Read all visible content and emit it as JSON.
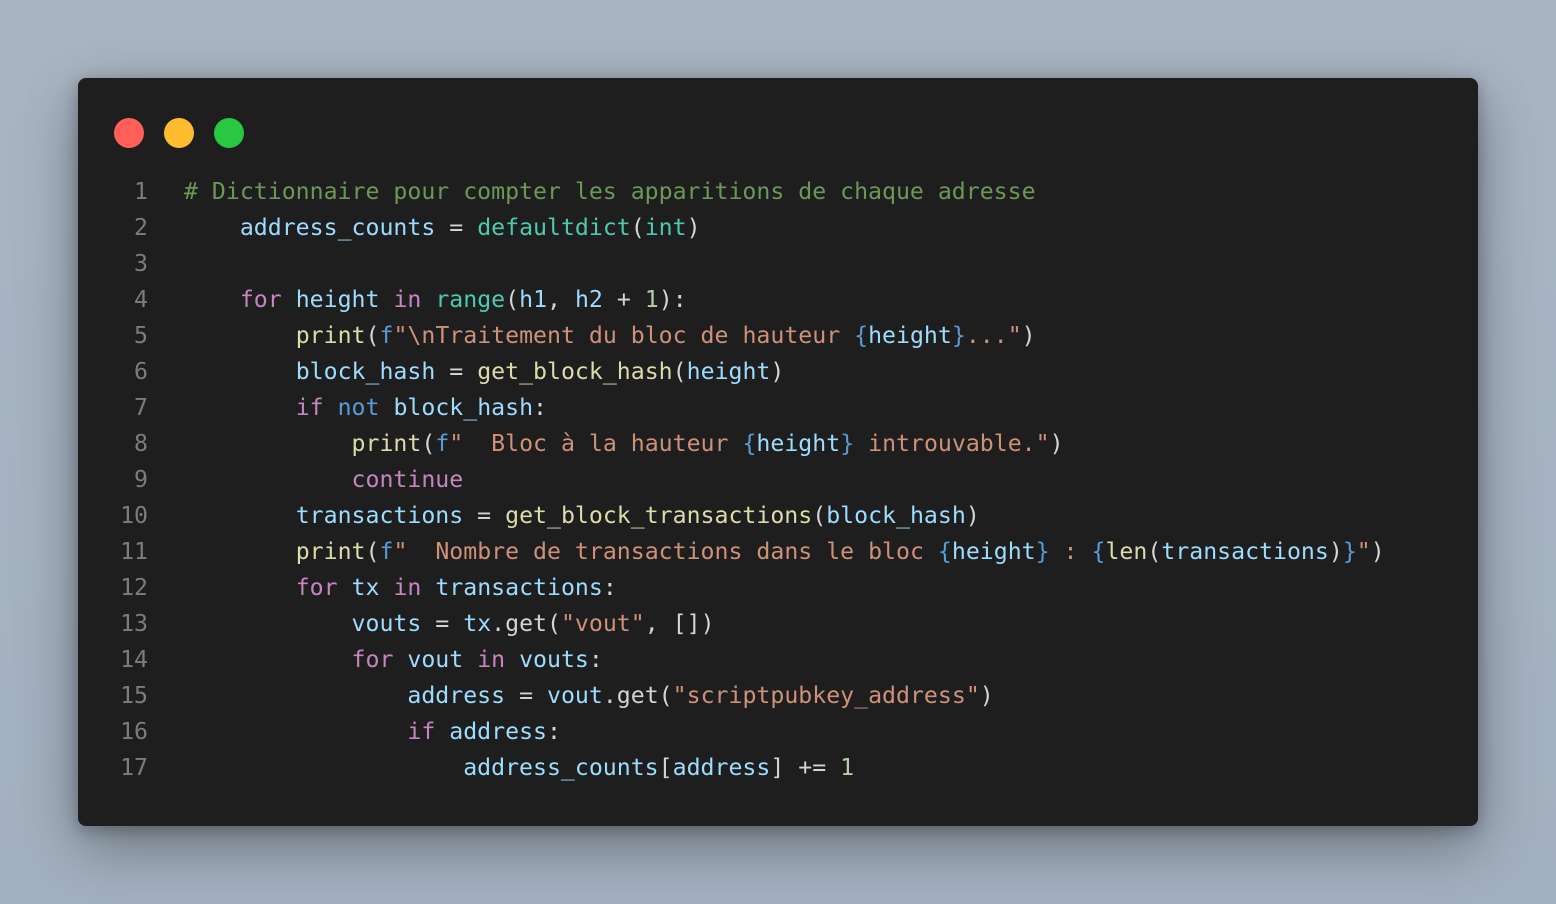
{
  "window": {
    "traffic_lights": [
      {
        "name": "close-button",
        "color": "#ff5f57"
      },
      {
        "name": "minimize-button",
        "color": "#febc2e"
      },
      {
        "name": "maximize-button",
        "color": "#28c840"
      }
    ]
  },
  "colors": {
    "comment": "#6a9955",
    "keyword": "#c586c0",
    "keyword_blue": "#569cd6",
    "variable": "#9cdcfe",
    "function": "#dcdcaa",
    "builtin_type": "#4ec9b0",
    "string": "#ce9178",
    "number": "#b5cea8",
    "brace": "#569cd6",
    "punctuation": "#d4d4d4",
    "line_number": "#7c7c7c"
  },
  "code": {
    "lines": [
      {
        "n": "1",
        "tokens": [
          {
            "t": "# Dictionnaire pour compter les apparitions de chaque adresse",
            "c": "comment"
          }
        ]
      },
      {
        "n": "2",
        "tokens": [
          {
            "t": "    ",
            "c": "punctuation"
          },
          {
            "t": "address_counts",
            "c": "variable"
          },
          {
            "t": " = ",
            "c": "punctuation"
          },
          {
            "t": "defaultdict",
            "c": "builtin_type"
          },
          {
            "t": "(",
            "c": "punctuation"
          },
          {
            "t": "int",
            "c": "builtin_type"
          },
          {
            "t": ")",
            "c": "punctuation"
          }
        ]
      },
      {
        "n": "3",
        "tokens": []
      },
      {
        "n": "4",
        "tokens": [
          {
            "t": "    ",
            "c": "punctuation"
          },
          {
            "t": "for",
            "c": "keyword"
          },
          {
            "t": " ",
            "c": "punctuation"
          },
          {
            "t": "height",
            "c": "variable"
          },
          {
            "t": " ",
            "c": "punctuation"
          },
          {
            "t": "in",
            "c": "keyword"
          },
          {
            "t": " ",
            "c": "punctuation"
          },
          {
            "t": "range",
            "c": "builtin_type"
          },
          {
            "t": "(",
            "c": "punctuation"
          },
          {
            "t": "h1",
            "c": "variable"
          },
          {
            "t": ", ",
            "c": "punctuation"
          },
          {
            "t": "h2",
            "c": "variable"
          },
          {
            "t": " + ",
            "c": "punctuation"
          },
          {
            "t": "1",
            "c": "number"
          },
          {
            "t": "):",
            "c": "punctuation"
          }
        ]
      },
      {
        "n": "5",
        "tokens": [
          {
            "t": "        ",
            "c": "punctuation"
          },
          {
            "t": "print",
            "c": "function"
          },
          {
            "t": "(",
            "c": "punctuation"
          },
          {
            "t": "f",
            "c": "keyword_blue"
          },
          {
            "t": "\"\\nTraitement du bloc de hauteur ",
            "c": "string"
          },
          {
            "t": "{",
            "c": "brace"
          },
          {
            "t": "height",
            "c": "variable"
          },
          {
            "t": "}",
            "c": "brace"
          },
          {
            "t": "...\"",
            "c": "string"
          },
          {
            "t": ")",
            "c": "punctuation"
          }
        ]
      },
      {
        "n": "6",
        "tokens": [
          {
            "t": "        ",
            "c": "punctuation"
          },
          {
            "t": "block_hash",
            "c": "variable"
          },
          {
            "t": " = ",
            "c": "punctuation"
          },
          {
            "t": "get_block_hash",
            "c": "function"
          },
          {
            "t": "(",
            "c": "punctuation"
          },
          {
            "t": "height",
            "c": "variable"
          },
          {
            "t": ")",
            "c": "punctuation"
          }
        ]
      },
      {
        "n": "7",
        "tokens": [
          {
            "t": "        ",
            "c": "punctuation"
          },
          {
            "t": "if",
            "c": "keyword"
          },
          {
            "t": " ",
            "c": "punctuation"
          },
          {
            "t": "not",
            "c": "keyword_blue"
          },
          {
            "t": " ",
            "c": "punctuation"
          },
          {
            "t": "block_hash",
            "c": "variable"
          },
          {
            "t": ":",
            "c": "punctuation"
          }
        ]
      },
      {
        "n": "8",
        "tokens": [
          {
            "t": "            ",
            "c": "punctuation"
          },
          {
            "t": "print",
            "c": "function"
          },
          {
            "t": "(",
            "c": "punctuation"
          },
          {
            "t": "f",
            "c": "keyword_blue"
          },
          {
            "t": "\"  Bloc à la hauteur ",
            "c": "string"
          },
          {
            "t": "{",
            "c": "brace"
          },
          {
            "t": "height",
            "c": "variable"
          },
          {
            "t": "}",
            "c": "brace"
          },
          {
            "t": " introuvable.\"",
            "c": "string"
          },
          {
            "t": ")",
            "c": "punctuation"
          }
        ]
      },
      {
        "n": "9",
        "tokens": [
          {
            "t": "            ",
            "c": "punctuation"
          },
          {
            "t": "continue",
            "c": "keyword"
          }
        ]
      },
      {
        "n": "10",
        "tokens": [
          {
            "t": "        ",
            "c": "punctuation"
          },
          {
            "t": "transactions",
            "c": "variable"
          },
          {
            "t": " = ",
            "c": "punctuation"
          },
          {
            "t": "get_block_transactions",
            "c": "function"
          },
          {
            "t": "(",
            "c": "punctuation"
          },
          {
            "t": "block_hash",
            "c": "variable"
          },
          {
            "t": ")",
            "c": "punctuation"
          }
        ]
      },
      {
        "n": "11",
        "tokens": [
          {
            "t": "        ",
            "c": "punctuation"
          },
          {
            "t": "print",
            "c": "function"
          },
          {
            "t": "(",
            "c": "punctuation"
          },
          {
            "t": "f",
            "c": "keyword_blue"
          },
          {
            "t": "\"  Nombre de transactions dans le bloc ",
            "c": "string"
          },
          {
            "t": "{",
            "c": "brace"
          },
          {
            "t": "height",
            "c": "variable"
          },
          {
            "t": "}",
            "c": "brace"
          },
          {
            "t": " : ",
            "c": "string"
          },
          {
            "t": "{",
            "c": "brace"
          },
          {
            "t": "len",
            "c": "function"
          },
          {
            "t": "(",
            "c": "punctuation"
          },
          {
            "t": "transactions",
            "c": "variable"
          },
          {
            "t": ")",
            "c": "punctuation"
          },
          {
            "t": "}",
            "c": "brace"
          },
          {
            "t": "\"",
            "c": "string"
          },
          {
            "t": ")",
            "c": "punctuation"
          }
        ]
      },
      {
        "n": "12",
        "tokens": [
          {
            "t": "        ",
            "c": "punctuation"
          },
          {
            "t": "for",
            "c": "keyword"
          },
          {
            "t": " ",
            "c": "punctuation"
          },
          {
            "t": "tx",
            "c": "variable"
          },
          {
            "t": " ",
            "c": "punctuation"
          },
          {
            "t": "in",
            "c": "keyword"
          },
          {
            "t": " ",
            "c": "punctuation"
          },
          {
            "t": "transactions",
            "c": "variable"
          },
          {
            "t": ":",
            "c": "punctuation"
          }
        ]
      },
      {
        "n": "13",
        "tokens": [
          {
            "t": "            ",
            "c": "punctuation"
          },
          {
            "t": "vouts",
            "c": "variable"
          },
          {
            "t": " = ",
            "c": "punctuation"
          },
          {
            "t": "tx",
            "c": "variable"
          },
          {
            "t": ".get(",
            "c": "punctuation"
          },
          {
            "t": "\"vout\"",
            "c": "string"
          },
          {
            "t": ", [])",
            "c": "punctuation"
          }
        ]
      },
      {
        "n": "14",
        "tokens": [
          {
            "t": "            ",
            "c": "punctuation"
          },
          {
            "t": "for",
            "c": "keyword"
          },
          {
            "t": " ",
            "c": "punctuation"
          },
          {
            "t": "vout",
            "c": "variable"
          },
          {
            "t": " ",
            "c": "punctuation"
          },
          {
            "t": "in",
            "c": "keyword"
          },
          {
            "t": " ",
            "c": "punctuation"
          },
          {
            "t": "vouts",
            "c": "variable"
          },
          {
            "t": ":",
            "c": "punctuation"
          }
        ]
      },
      {
        "n": "15",
        "tokens": [
          {
            "t": "                ",
            "c": "punctuation"
          },
          {
            "t": "address",
            "c": "variable"
          },
          {
            "t": " = ",
            "c": "punctuation"
          },
          {
            "t": "vout",
            "c": "variable"
          },
          {
            "t": ".get(",
            "c": "punctuation"
          },
          {
            "t": "\"scriptpubkey_address\"",
            "c": "string"
          },
          {
            "t": ")",
            "c": "punctuation"
          }
        ]
      },
      {
        "n": "16",
        "tokens": [
          {
            "t": "                ",
            "c": "punctuation"
          },
          {
            "t": "if",
            "c": "keyword"
          },
          {
            "t": " ",
            "c": "punctuation"
          },
          {
            "t": "address",
            "c": "variable"
          },
          {
            "t": ":",
            "c": "punctuation"
          }
        ]
      },
      {
        "n": "17",
        "tokens": [
          {
            "t": "                    ",
            "c": "punctuation"
          },
          {
            "t": "address_counts",
            "c": "variable"
          },
          {
            "t": "[",
            "c": "punctuation"
          },
          {
            "t": "address",
            "c": "variable"
          },
          {
            "t": "] += ",
            "c": "punctuation"
          },
          {
            "t": "1",
            "c": "number"
          }
        ]
      }
    ]
  }
}
